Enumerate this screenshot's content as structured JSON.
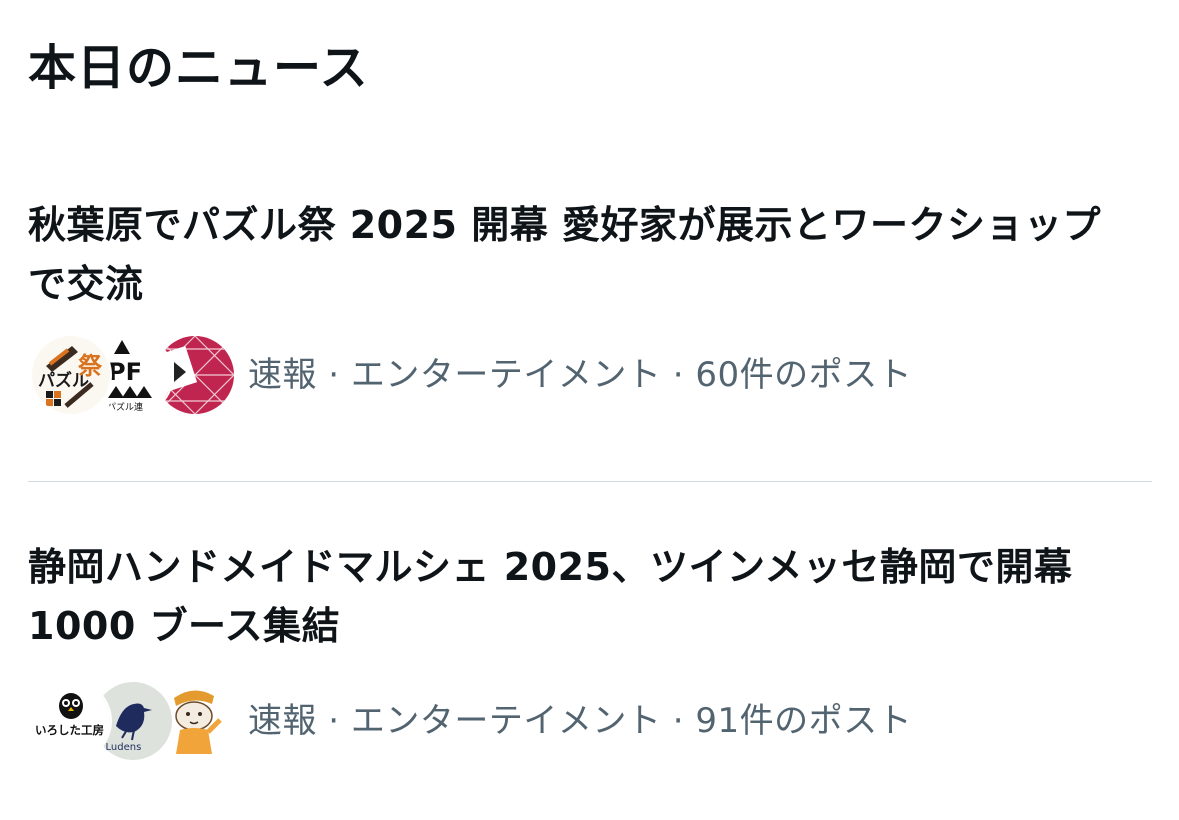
{
  "section": {
    "title": "本日のニュース"
  },
  "news": [
    {
      "headline": "秋葉原でパズル祭 2025 開幕 愛好家が展示とワークショップで交流",
      "meta": "速報 · エンターテイメント · 60件のポスト",
      "avatars": [
        {
          "name": "puzzle-fest-logo",
          "text": "パズル祭"
        },
        {
          "name": "pf-logo",
          "text": "PF",
          "caption": "本パズル連"
        },
        {
          "name": "asanoha-pattern-logo"
        }
      ]
    },
    {
      "headline": "静岡ハンドメイドマルシェ 2025、ツインメッセ静岡で開幕 1000 ブース集結",
      "meta": "速報 · エンターテイメント · 91件のポスト",
      "avatars": [
        {
          "name": "owl-logo",
          "text": "いろした工房"
        },
        {
          "name": "crow-logo",
          "text": "u Ludens"
        },
        {
          "name": "character-illustration"
        }
      ]
    }
  ],
  "colors": {
    "text_primary": "#0f1419",
    "text_secondary": "#536471",
    "divider": "#cfd9de",
    "accent_red": "#c0254f",
    "accent_orange": "#d9731f"
  }
}
